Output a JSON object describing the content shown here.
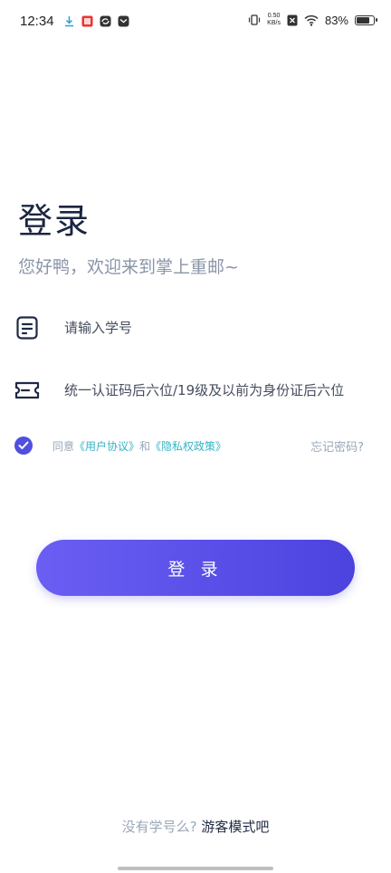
{
  "status_bar": {
    "time": "12:34",
    "net_speed_value": "0.50",
    "net_speed_unit": "KB/s",
    "battery_pct": "83%",
    "battery_level": 0.83,
    "left_icons": [
      "download-icon",
      "app-notification-icon",
      "sync-icon",
      "message-icon"
    ],
    "right_icons": [
      "vibrate-icon",
      "no-sim-icon",
      "wifi-icon",
      "battery-icon"
    ]
  },
  "page": {
    "title": "登录",
    "subtitle": "您好鸭，欢迎来到掌上重邮~"
  },
  "form": {
    "student_id": {
      "placeholder": "请输入学号",
      "value": "",
      "icon": "id-card-icon"
    },
    "password": {
      "placeholder": "统一认证码后六位/19级及以前为身份证后六位",
      "value": "",
      "icon": "ticket-icon"
    }
  },
  "agreement": {
    "checked": true,
    "prefix": "同意",
    "user_agreement": "《用户协议》",
    "and": "和",
    "privacy_policy": "《隐私权政策》",
    "forgot_password": "忘记密码?"
  },
  "login_button": {
    "label": "登 录"
  },
  "guest": {
    "question": "没有学号么?",
    "link": "游客模式吧"
  },
  "colors": {
    "accent": "#4f4fe0",
    "link": "#36b3c6",
    "muted": "#9aa7b8",
    "title": "#1b2540"
  }
}
